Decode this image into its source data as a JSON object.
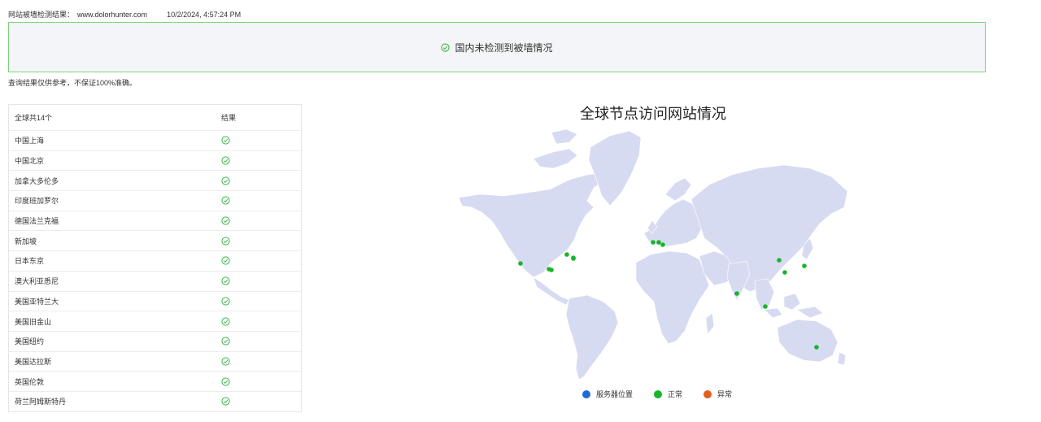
{
  "header": {
    "label": "网站被墙检测结果：",
    "domain": "www.dolorhunter.com",
    "timestamp": "10/2/2024, 4:57:24 PM"
  },
  "banner": {
    "message": "国内未检测到被墙情况",
    "icon": "check-circle-icon",
    "border_color": "#7dd47d",
    "icon_color": "#3bb54a"
  },
  "disclaimer": "查询结果仅供参考，不保证100%准确。",
  "table": {
    "header_left": "全球共14个",
    "header_right": "结果",
    "rows": [
      {
        "location": "中国上海",
        "status": "ok"
      },
      {
        "location": "中国北京",
        "status": "ok"
      },
      {
        "location": "加拿大多伦多",
        "status": "ok"
      },
      {
        "location": "印度班加罗尔",
        "status": "ok"
      },
      {
        "location": "德国法兰克福",
        "status": "ok"
      },
      {
        "location": "新加坡",
        "status": "ok"
      },
      {
        "location": "日本东京",
        "status": "ok"
      },
      {
        "location": "澳大利亚悉尼",
        "status": "ok"
      },
      {
        "location": "美国亚特兰大",
        "status": "ok"
      },
      {
        "location": "美国旧金山",
        "status": "ok"
      },
      {
        "location": "美国纽约",
        "status": "ok"
      },
      {
        "location": "美国达拉斯",
        "status": "ok"
      },
      {
        "location": "英国伦敦",
        "status": "ok"
      },
      {
        "location": "荷兰阿姆斯特丹",
        "status": "ok"
      }
    ]
  },
  "map": {
    "title": "全球节点访问网站情况",
    "land_color": "#d7dbf2",
    "ok_color": "#19b42a"
  },
  "legend": [
    {
      "label": "服务器位置",
      "color": "#1e6bd6"
    },
    {
      "label": "正常",
      "color": "#19b42a"
    },
    {
      "label": "异常",
      "color": "#e35d1d"
    }
  ]
}
